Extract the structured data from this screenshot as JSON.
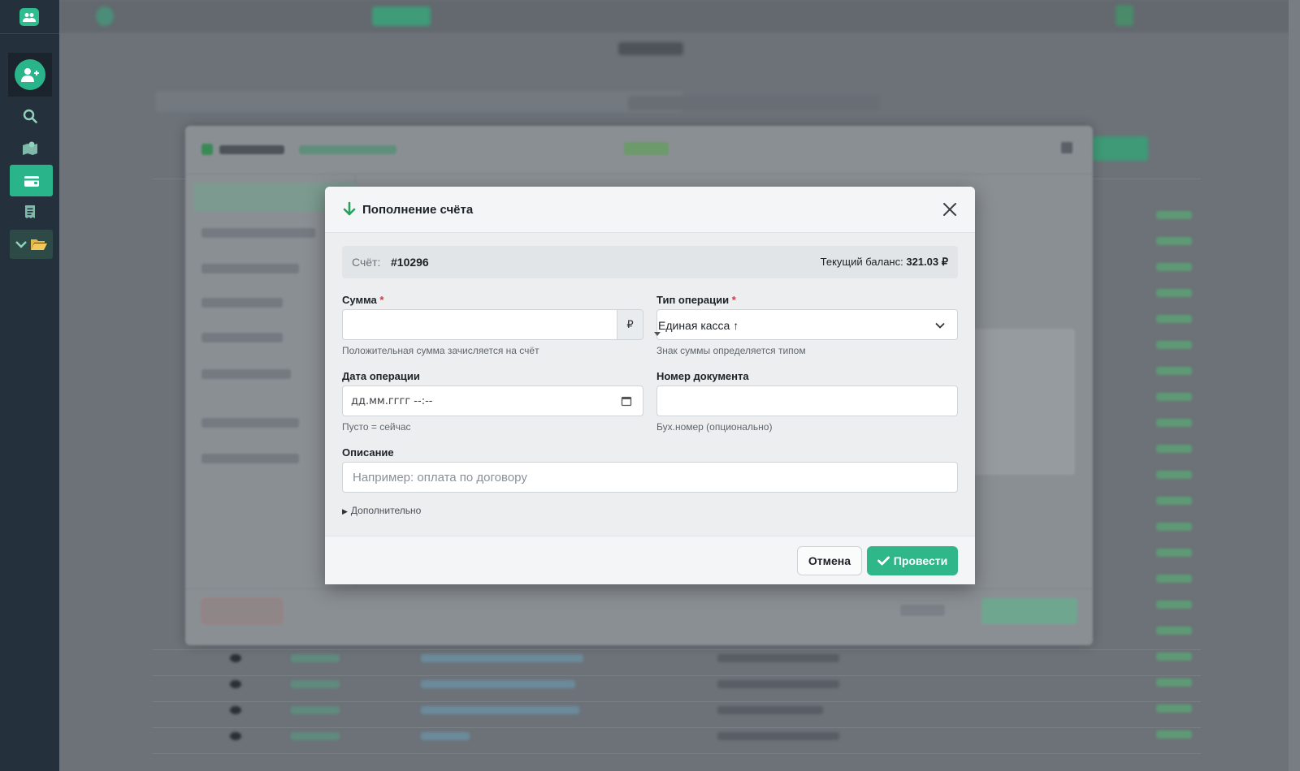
{
  "dialog": {
    "title": "Пополнение счёта",
    "account_label": "Счёт:",
    "account_number": "#10296",
    "balance_label": "Текущий баланс:",
    "balance_value": "321.03 ₽"
  },
  "fields": {
    "sum": {
      "label": "Сумма",
      "required_mark": "*",
      "value": "",
      "currency": "₽",
      "hint": "Положительная сумма зачисляется на счёт"
    },
    "op_type": {
      "label": "Тип операции",
      "required_mark": "*",
      "value": "Единая касса ↑",
      "hint": "Знак суммы определяется типом"
    },
    "op_date": {
      "label": "Дата операции",
      "value": "дд.мм.гггг --:--",
      "hint": "Пусто = сейчас"
    },
    "doc_number": {
      "label": "Номер документа",
      "value": "",
      "hint": "Бух.номер (опционально)"
    },
    "description": {
      "label": "Описание",
      "placeholder": "Например: оплата по договору"
    },
    "extra_toggle": "Дополнительно"
  },
  "buttons": {
    "cancel": "Отмена",
    "submit": "Провести"
  },
  "icons": {
    "title_icon": "arrow-down-icon",
    "close": "close-icon",
    "select": "chevron-down-icon",
    "date": "calendar-icon",
    "submit": "check-icon"
  },
  "colors": {
    "accent": "#30b789",
    "required": "#d9363e",
    "sidebar": "#25303d"
  }
}
